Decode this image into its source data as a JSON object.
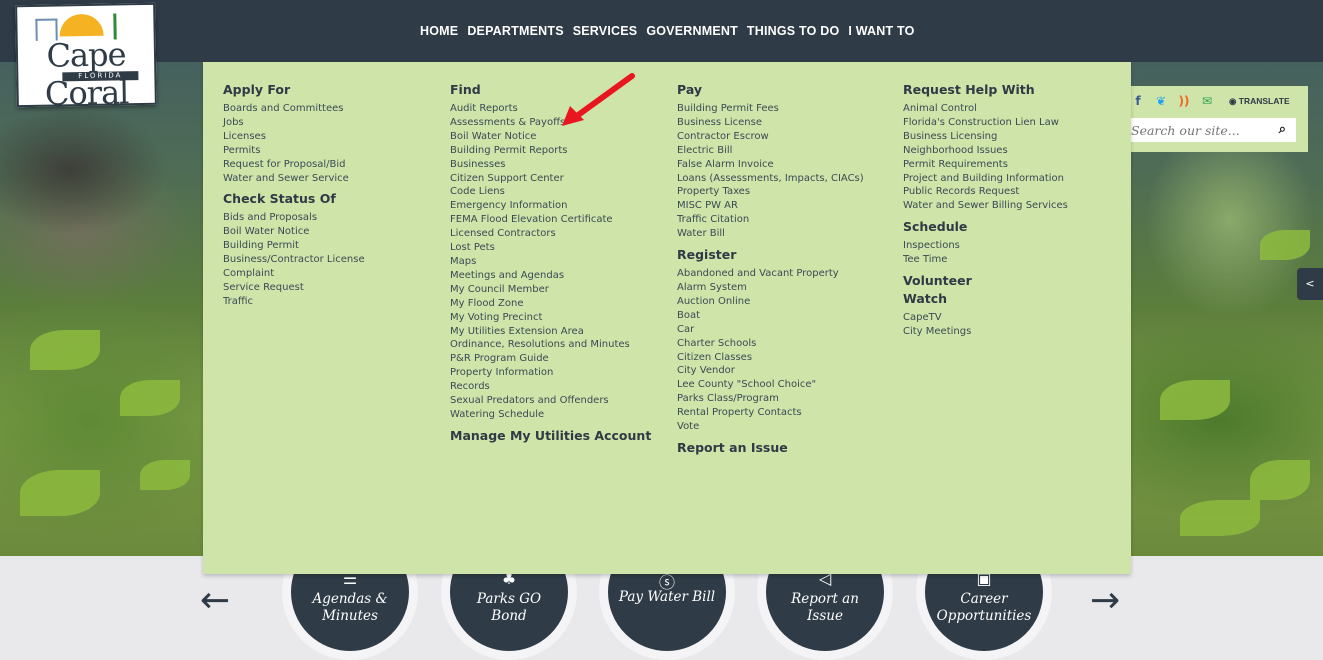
{
  "logo": {
    "name": "Cape Coral",
    "sub": "FLORIDA"
  },
  "nav": [
    "HOME",
    "DEPARTMENTS",
    "SERVICES",
    "GOVERNMENT",
    "THINGS TO DO",
    "I WANT TO"
  ],
  "menu": {
    "apply_for": {
      "heading": "Apply For",
      "items": [
        "Boards and Committees",
        "Jobs",
        "Licenses",
        "Permits",
        "Request for Proposal/Bid",
        "Water and Sewer Service"
      ]
    },
    "check_status": {
      "heading": "Check Status Of",
      "items": [
        "Bids and Proposals",
        "Boil Water Notice",
        "Building Permit",
        "Business/Contractor License",
        "Complaint",
        "Service Request",
        "Traffic"
      ]
    },
    "find": {
      "heading": "Find",
      "items": [
        "Audit Reports",
        "Assessments & Payoffs",
        "Boil Water Notice",
        "Building Permit Reports",
        "Businesses",
        "Citizen Support Center",
        "Code Liens",
        "Emergency Information",
        "FEMA Flood Elevation Certificate",
        "Licensed Contractors",
        "Lost Pets",
        "Maps",
        "Meetings and Agendas",
        "My Council Member",
        "My Flood Zone",
        "My Voting Precinct",
        "My Utilities Extension Area",
        "Ordinance, Resolutions and Minutes",
        "P&R Program Guide",
        "Property Information",
        "Records",
        "Sexual Predators and Offenders",
        "Watering Schedule"
      ]
    },
    "manage_utilities": "Manage My Utilities Account",
    "pay": {
      "heading": "Pay",
      "items": [
        "Building Permit Fees",
        "Business License",
        "Contractor Escrow",
        "Electric Bill",
        "False Alarm Invoice",
        "Loans (Assessments, Impacts, CIACs)",
        "Property Taxes",
        "MISC PW AR",
        "Traffic Citation",
        "Water Bill"
      ]
    },
    "register": {
      "heading": "Register",
      "items": [
        "Abandoned and Vacant Property",
        "Alarm System",
        "Auction Online",
        "Boat",
        "Car",
        "Charter Schools",
        "Citizen Classes",
        "City Vendor",
        "Lee County \"School Choice\"",
        "Parks Class/Program",
        "Rental Property Contacts",
        "Vote"
      ]
    },
    "report_issue": "Report an Issue",
    "request_help": {
      "heading": "Request Help With",
      "items": [
        "Animal Control",
        "Florida's Construction Lien Law",
        "Business Licensing",
        "Neighborhood Issues",
        "Permit Requirements",
        "Project and Building Information",
        "Public Records Request",
        "Water and Sewer Billing Services"
      ]
    },
    "schedule": {
      "heading": "Schedule",
      "items": [
        "Inspections",
        "Tee Time"
      ]
    },
    "volunteer": "Volunteer",
    "watch": {
      "heading": "Watch",
      "items": [
        "CapeTV",
        "City Meetings"
      ]
    }
  },
  "social": {
    "translate": "TRANSLATE",
    "search_placeholder": "Search our site...",
    "colors": {
      "facebook": "#3b5998",
      "twitter": "#1da1f2",
      "rss": "#f26522",
      "email": "#2ea44f"
    }
  },
  "quick_links": [
    {
      "label": "Agendas &\nMinutes",
      "icon": "list-icon"
    },
    {
      "label": "Parks GO\nBond",
      "icon": "tree-icon"
    },
    {
      "label": "Pay Water Bill",
      "icon": "dollar-icon"
    },
    {
      "label": "Report an\nIssue",
      "icon": "megaphone-icon"
    },
    {
      "label": "Career\nOpportunities",
      "icon": "briefcase-icon"
    }
  ]
}
